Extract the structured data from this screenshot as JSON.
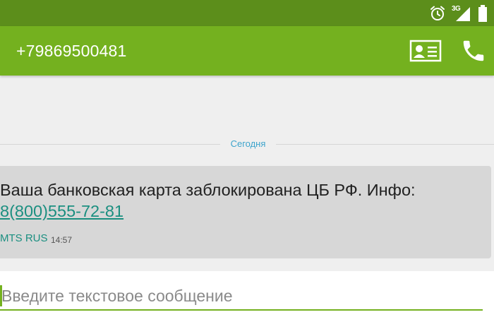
{
  "status_bar": {
    "network_type": "3G",
    "icons": [
      "alarm-icon",
      "signal-icon",
      "battery-icon"
    ],
    "color": "#5c8e1b"
  },
  "app_bar": {
    "title": "+79869500481",
    "actions": [
      "contact-card-icon",
      "phone-icon"
    ],
    "color": "#74b11f"
  },
  "conversation": {
    "date_divider": "Сегодня",
    "messages": [
      {
        "text": "Ваша банковская карта заблокирована ЦБ РФ. Инфо:",
        "link": "8(800)555-72-81",
        "sender": "MTS RUS",
        "time": "14:57"
      }
    ]
  },
  "compose": {
    "placeholder": "Введите текстовое сообщение",
    "value": ""
  },
  "colors": {
    "accent": "#74b11f",
    "link": "#1b8f80",
    "date": "#3da4cc",
    "bubble": "#d7d7d7"
  }
}
